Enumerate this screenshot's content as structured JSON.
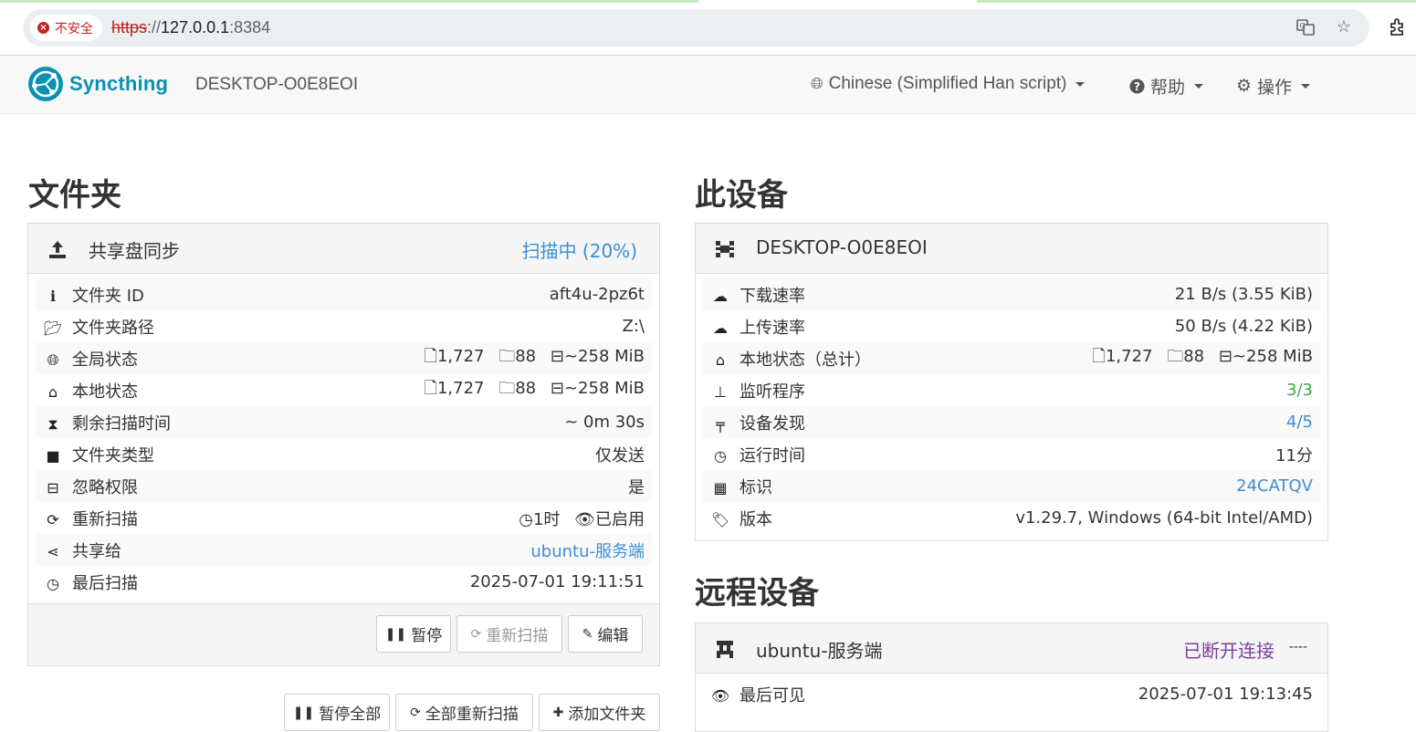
{
  "browser": {
    "security_label": "不安全",
    "url_proto": "https",
    "url_rest_prefix": "://",
    "url_host": "127.0.0.1",
    "url_port": ":8384"
  },
  "navbar": {
    "brand": "Syncthing",
    "device_name": "DESKTOP-O0E8EOI",
    "language": "Chinese (Simplified Han script)",
    "help": "帮助",
    "actions": "操作"
  },
  "folders": {
    "heading": "文件夹",
    "folder": {
      "name": "共享盘同步",
      "status": "扫描中 (20%)",
      "progress_percent": 20,
      "rows": [
        {
          "icon": "info-icon",
          "label": "文件夹 ID",
          "value": "aft4u-2pz6t"
        },
        {
          "icon": "folder-open-icon",
          "label": "文件夹路径",
          "value": "Z:\\"
        },
        {
          "icon": "globe-icon",
          "label": "全局状态",
          "files": "1,727",
          "dirs": "88",
          "size": "~258 MiB"
        },
        {
          "icon": "home-icon",
          "label": "本地状态",
          "files": "1,727",
          "dirs": "88",
          "size": "~258 MiB"
        },
        {
          "icon": "hourglass-icon",
          "label": "剩余扫描时间",
          "value": "~ 0m 30s"
        },
        {
          "icon": "folder-icon",
          "label": "文件夹类型",
          "value": "仅发送"
        },
        {
          "icon": "minus-square-icon",
          "label": "忽略权限",
          "value": "是"
        },
        {
          "icon": "refresh-icon",
          "label": "重新扫描",
          "interval": "1时",
          "watcher": "已启用"
        },
        {
          "icon": "share-icon",
          "label": "共享给",
          "value": "ubuntu-服务端"
        },
        {
          "icon": "clock-icon",
          "label": "最后扫描",
          "value": "2025-07-01 19:11:51"
        }
      ],
      "buttons": {
        "pause": "暂停",
        "rescan": "重新扫描",
        "edit": "编辑"
      }
    },
    "footer_buttons": {
      "pause_all": "暂停全部",
      "rescan_all": "全部重新扫描",
      "add_folder": "添加文件夹"
    }
  },
  "this_device": {
    "heading": "此设备",
    "name": "DESKTOP-O0E8EOI",
    "rows": [
      {
        "icon": "cloud-download-icon",
        "label": "下载速率",
        "value": "21 B/s (3.55 KiB)"
      },
      {
        "icon": "cloud-upload-icon",
        "label": "上传速率",
        "value": "50 B/s (4.22 KiB)"
      },
      {
        "icon": "home-icon",
        "label": "本地状态（总计）",
        "files": "1,727",
        "dirs": "88",
        "size": "~258 MiB"
      },
      {
        "icon": "sitemap-icon",
        "label": "监听程序",
        "value": "3/3"
      },
      {
        "icon": "signpost-icon",
        "label": "设备发现",
        "value": "4/5"
      },
      {
        "icon": "clock-icon",
        "label": "运行时间",
        "value": "11分"
      },
      {
        "icon": "qrcode-icon",
        "label": "标识",
        "value": "24CATQV"
      },
      {
        "icon": "tag-icon",
        "label": "版本",
        "value": "v1.29.7, Windows (64-bit Intel/AMD)"
      }
    ]
  },
  "remote_devices": {
    "heading": "远程设备",
    "device": {
      "name": "ubuntu-服务端",
      "status": "已断开连接",
      "status_suffix": "----",
      "rows": [
        {
          "icon": "eye-icon",
          "label": "最后可见",
          "value": "2025-07-01 19:13:45"
        }
      ]
    }
  },
  "colors": {
    "link": "#3b8ed6",
    "green": "#3aa745",
    "purple": "#7b3fa3",
    "brand": "#0891b2"
  }
}
